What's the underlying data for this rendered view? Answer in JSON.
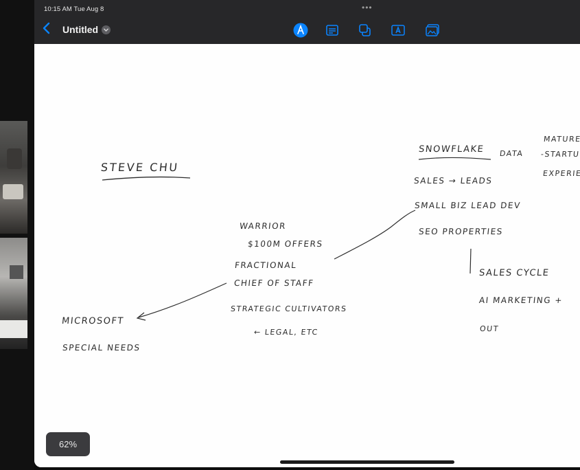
{
  "status_bar": {
    "time_date": "10:15 AM  Tue Aug 8",
    "more": "•••"
  },
  "toolbar": {
    "title": "Untitled",
    "tools": [
      {
        "name": "pen-tool-icon"
      },
      {
        "name": "text-box-icon"
      },
      {
        "name": "shapes-icon"
      },
      {
        "name": "text-a-icon"
      },
      {
        "name": "image-icon"
      }
    ]
  },
  "notes": {
    "steve_chu": "STEVE  CHU",
    "snowflake": "SNOWFLAKE",
    "data": "DATA",
    "mature": "MATURE",
    "startup": "-STARTUP",
    "experience": "EXPERIE",
    "sales_leads": "SALES → LEADS",
    "small_biz": "SMALL BIZ  LEAD DEV",
    "seo_properties": "SEO  PROPERTIES",
    "warrior": "WARRIOR",
    "offers": "$100M  OFFERS",
    "fractional": "FRACTIONAL",
    "chief_of_staff": "CHIEF OF STAFF",
    "strategic": "STRATEGIC  CULTIVATORS",
    "legal": "← LEGAL, ETC",
    "microsoft": "MICROSOFT",
    "special_needs": "SPECIAL NEEDS",
    "sales_cycle": "SALES  CYCLE",
    "ai_marketing": "AI  MARKETING +",
    "out": "OUT"
  },
  "zoom": "62%"
}
